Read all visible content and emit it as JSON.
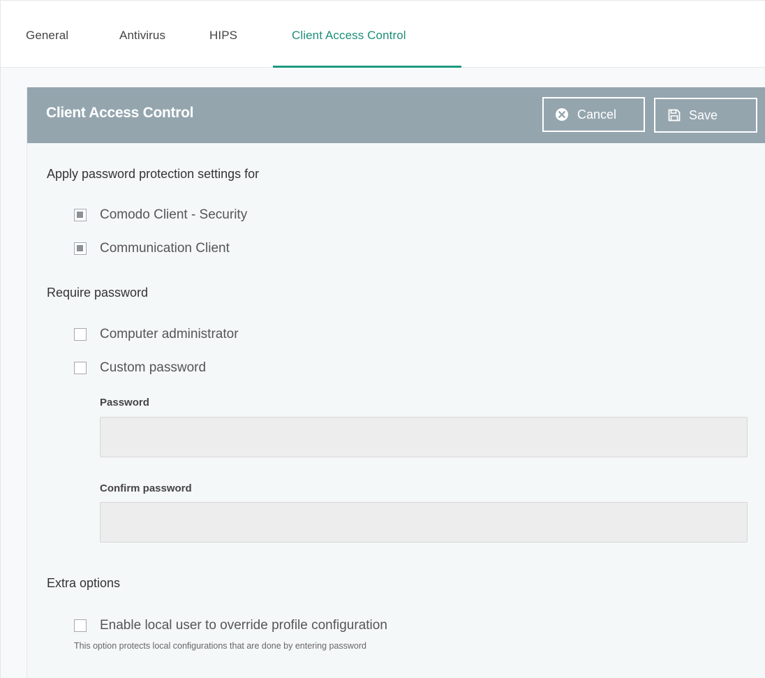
{
  "tabs": [
    {
      "label": "General",
      "active": false
    },
    {
      "label": "Antivirus",
      "active": false
    },
    {
      "label": "HIPS",
      "active": false
    },
    {
      "label": "Client Access Control",
      "active": true
    }
  ],
  "colors": {
    "accent": "#1c9a80",
    "header_bg": "#94a5ae",
    "page_bg": "#f7f9fa"
  },
  "panel": {
    "title": "Client Access Control",
    "cancel_label": "Cancel",
    "save_label": "Save",
    "cancel_icon": "cancel-circle-x-icon",
    "save_icon": "floppy-disk-icon"
  },
  "password_protection": {
    "heading": "Apply password protection settings for",
    "options": [
      {
        "label": "Comodo Client - Security",
        "state": "indeterminate"
      },
      {
        "label": "Communication Client",
        "state": "indeterminate"
      }
    ]
  },
  "require_password": {
    "heading": "Require password",
    "options": [
      {
        "label": "Computer administrator",
        "checked": false
      },
      {
        "label": "Custom password",
        "checked": false
      }
    ],
    "password_label": "Password",
    "password_value": "",
    "confirm_label": "Confirm password",
    "confirm_value": ""
  },
  "extra_options": {
    "heading": "Extra options",
    "override_label": "Enable local user to override profile configuration",
    "override_checked": false,
    "hint": "This option protects local configurations that are done by entering password"
  }
}
